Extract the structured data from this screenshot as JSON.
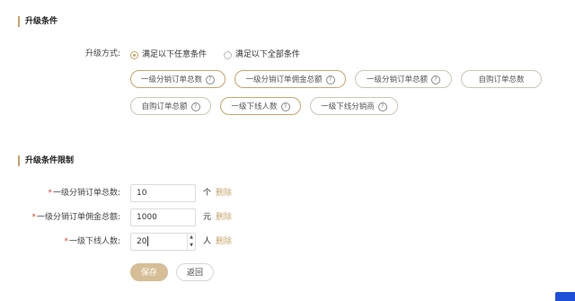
{
  "section1": {
    "title": "升级条件"
  },
  "upgrade_mode": {
    "label": "升级方式:",
    "options": [
      {
        "label": "满足以下任意条件",
        "checked": true
      },
      {
        "label": "满足以下全部条件",
        "checked": false
      }
    ]
  },
  "conditions": [
    {
      "label": "一级分销订单总数",
      "help_icon": "question-circle-icon",
      "selected": true
    },
    {
      "label": "一级分销订单佣金总额",
      "help_icon": "question-circle-icon",
      "selected": true
    },
    {
      "label": "一级分销订单总额",
      "help_icon": "question-circle-icon",
      "selected": false
    },
    {
      "label": "自购订单总数",
      "selected": false
    },
    {
      "label": "自购订单总额",
      "help_icon": "question-circle-icon",
      "selected": false
    },
    {
      "label": "一级下线人数",
      "help_icon": "question-circle-icon",
      "selected": true
    },
    {
      "label": "一级下线分销商",
      "help_icon": "question-circle-icon",
      "selected": false
    }
  ],
  "section2": {
    "title": "升级条件限制"
  },
  "limits": [
    {
      "label": "一级分销订单总数:",
      "required": "*",
      "value": "10",
      "unit": "个",
      "delete": "删除"
    },
    {
      "label": "一级分销订单佣金总额:",
      "required": "*",
      "value": "1000",
      "unit": "元",
      "delete": "删除"
    },
    {
      "label": "一级下线人数:",
      "required": "*",
      "value": "20",
      "unit": "人",
      "delete": "删除"
    }
  ],
  "actions": {
    "save": "保存",
    "back": "返回"
  },
  "colors": {
    "accent": "#c8a46b",
    "required": "#e0432b",
    "primary_button": "#d6be96"
  }
}
